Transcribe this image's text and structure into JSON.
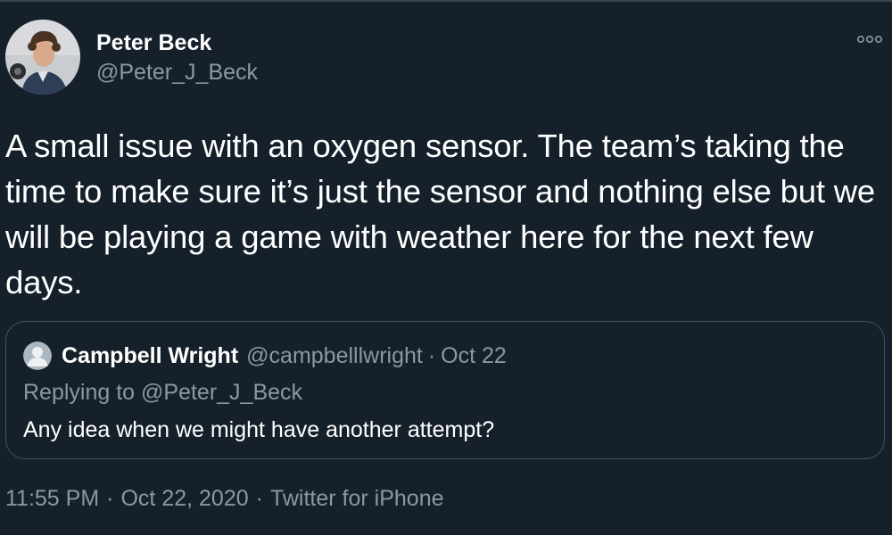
{
  "author": {
    "name": "Peter Beck",
    "handle": "@Peter_J_Beck"
  },
  "more_icon": "more-horizontal-icon",
  "tweet": {
    "text": "A small issue with an oxygen sensor. The team’s taking the time to make sure it’s just the sensor and nothing else but we will be playing a game with weather here for the next few days."
  },
  "quote": {
    "name": "Campbell Wright",
    "handle": "@campbelllwright",
    "separator": "·",
    "date": "Oct 22",
    "replying_to": "Replying to @Peter_J_Beck",
    "text": "Any idea when we might have another attempt?"
  },
  "meta": {
    "time": "11:55 PM",
    "separator": "·",
    "date": "Oct 22, 2020",
    "source": "Twitter for iPhone"
  },
  "colors": {
    "background": "#15202b",
    "text_primary": "#ffffff",
    "text_secondary": "#8899a6",
    "border": "#3d5466"
  }
}
